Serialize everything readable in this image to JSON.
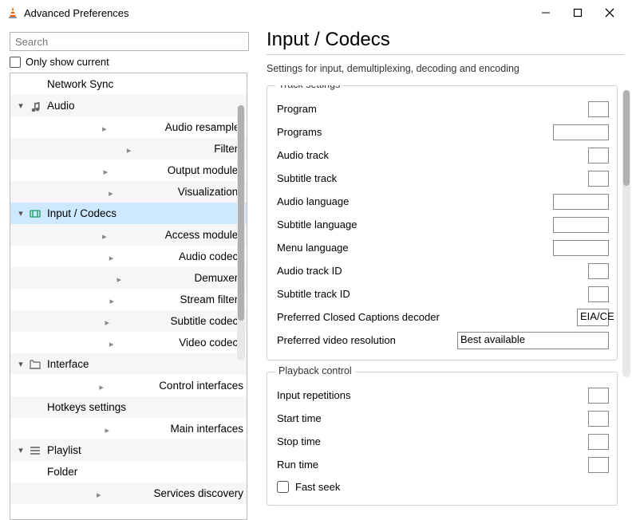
{
  "window": {
    "title": "Advanced Preferences"
  },
  "sidebar": {
    "search_placeholder": "Search",
    "only_show_label": "Only show current",
    "items": [
      {
        "label": "Network Sync",
        "indent": 1,
        "expander": "",
        "icon": ""
      },
      {
        "label": "Audio",
        "indent": 0,
        "expander": "down",
        "icon": "audio"
      },
      {
        "label": "Audio resampler",
        "indent": 1,
        "expander": "right",
        "icon": ""
      },
      {
        "label": "Filters",
        "indent": 1,
        "expander": "right",
        "icon": ""
      },
      {
        "label": "Output modules",
        "indent": 1,
        "expander": "right",
        "icon": ""
      },
      {
        "label": "Visualizations",
        "indent": 1,
        "expander": "right",
        "icon": ""
      },
      {
        "label": "Input / Codecs",
        "indent": 0,
        "expander": "down",
        "icon": "codec",
        "selected": true
      },
      {
        "label": "Access modules",
        "indent": 1,
        "expander": "right",
        "icon": ""
      },
      {
        "label": "Audio codecs",
        "indent": 1,
        "expander": "right",
        "icon": ""
      },
      {
        "label": "Demuxers",
        "indent": 1,
        "expander": "right",
        "icon": ""
      },
      {
        "label": "Stream filters",
        "indent": 1,
        "expander": "right",
        "icon": ""
      },
      {
        "label": "Subtitle codecs",
        "indent": 1,
        "expander": "right",
        "icon": ""
      },
      {
        "label": "Video codecs",
        "indent": 1,
        "expander": "right",
        "icon": ""
      },
      {
        "label": "Interface",
        "indent": 0,
        "expander": "down",
        "icon": "interface"
      },
      {
        "label": "Control interfaces",
        "indent": 1,
        "expander": "right",
        "icon": ""
      },
      {
        "label": "Hotkeys settings",
        "indent": 1,
        "expander": "",
        "icon": ""
      },
      {
        "label": "Main interfaces",
        "indent": 1,
        "expander": "right",
        "icon": ""
      },
      {
        "label": "Playlist",
        "indent": 0,
        "expander": "down",
        "icon": "playlist"
      },
      {
        "label": "Folder",
        "indent": 1,
        "expander": "",
        "icon": ""
      },
      {
        "label": "Services discovery",
        "indent": 1,
        "expander": "right",
        "icon": ""
      }
    ]
  },
  "main": {
    "title": "Input / Codecs",
    "subtitle": "Settings for input, demultiplexing, decoding and encoding",
    "groups": [
      {
        "title": "Track settings",
        "rows": [
          {
            "label": "Program",
            "input": "sm"
          },
          {
            "label": "Programs",
            "input": "md"
          },
          {
            "label": "Audio track",
            "input": "sm"
          },
          {
            "label": "Subtitle track",
            "input": "sm"
          },
          {
            "label": "Audio language",
            "input": "md"
          },
          {
            "label": "Subtitle language",
            "input": "md"
          },
          {
            "label": "Menu language",
            "input": "md"
          },
          {
            "label": "Audio track ID",
            "input": "sm"
          },
          {
            "label": "Subtitle track ID",
            "input": "sm"
          },
          {
            "label": "Preferred Closed Captions decoder",
            "select": "EIA/CE",
            "selw": "cut"
          },
          {
            "label": "Preferred video resolution",
            "select": "Best available",
            "selw": "wide"
          }
        ]
      },
      {
        "title": "Playback control",
        "rows": [
          {
            "label": "Input repetitions",
            "input": "sm"
          },
          {
            "label": "Start time",
            "input": "sm"
          },
          {
            "label": "Stop time",
            "input": "sm"
          },
          {
            "label": "Run time",
            "input": "sm"
          },
          {
            "checkbox": "Fast seek"
          }
        ]
      }
    ]
  }
}
